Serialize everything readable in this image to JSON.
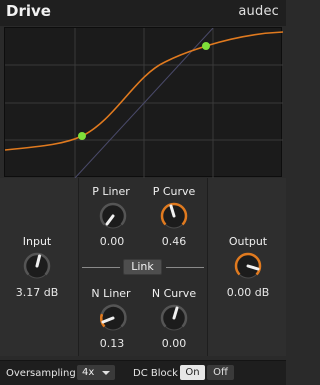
{
  "header": {
    "title": "Drive",
    "brand": "audec"
  },
  "graph": {
    "accent": "#e07a1f",
    "point_color": "#7ee03a",
    "grid_color": "#3c3c3c"
  },
  "controls": {
    "input": {
      "label": "Input",
      "value": "3.17 dB",
      "level": 0.55
    },
    "output": {
      "label": "Output",
      "value": "0.00 dB",
      "level": 0.7
    },
    "p_liner": {
      "label": "P Liner",
      "value": "0.00",
      "level": 0.5
    },
    "p_curve": {
      "label": "P Curve",
      "value": "0.46",
      "level": 0.46
    },
    "n_liner": {
      "label": "N Liner",
      "value": "0.13",
      "level": 0.2
    },
    "n_curve": {
      "label": "N Curve",
      "value": "0.00",
      "level": 0.55
    }
  },
  "link": {
    "label": "Link"
  },
  "footer": {
    "oversampling_label": "Oversampling",
    "oversampling_value": "4x",
    "dc_block_label": "DC Block",
    "on_label": "On",
    "off_label": "Off"
  }
}
